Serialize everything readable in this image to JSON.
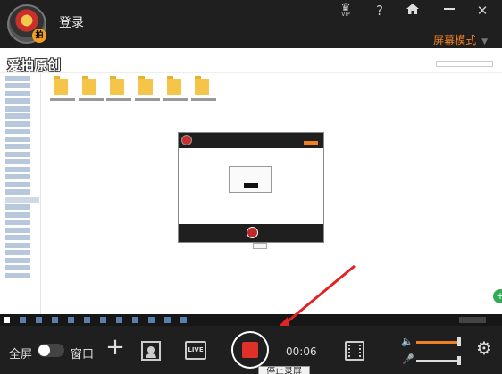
{
  "header": {
    "login_label": "登录",
    "vip_label": "VIP",
    "logo_badge": "拍",
    "mode_label": "屏幕模式"
  },
  "preview": {
    "watermark": "爱拍原创",
    "folders": 6
  },
  "toolbar": {
    "fullscreen_label": "全屏",
    "window_label": "窗口",
    "live_label": "LIVE",
    "timer": "00:06",
    "record_tooltip": "停止录屏",
    "speaker_volume": 0.95,
    "mic_volume": 0.95
  },
  "colors": {
    "accent": "#f08020",
    "record": "#e0302a",
    "background": "#1f1f1f"
  },
  "icons": [
    "vip-crown-icon",
    "help-icon",
    "home-icon",
    "minimize-icon",
    "close-icon",
    "add-icon",
    "camera-icon",
    "live-icon",
    "record-stop-icon",
    "film-icon",
    "speaker-icon",
    "microphone-icon",
    "settings-gear-icon"
  ]
}
